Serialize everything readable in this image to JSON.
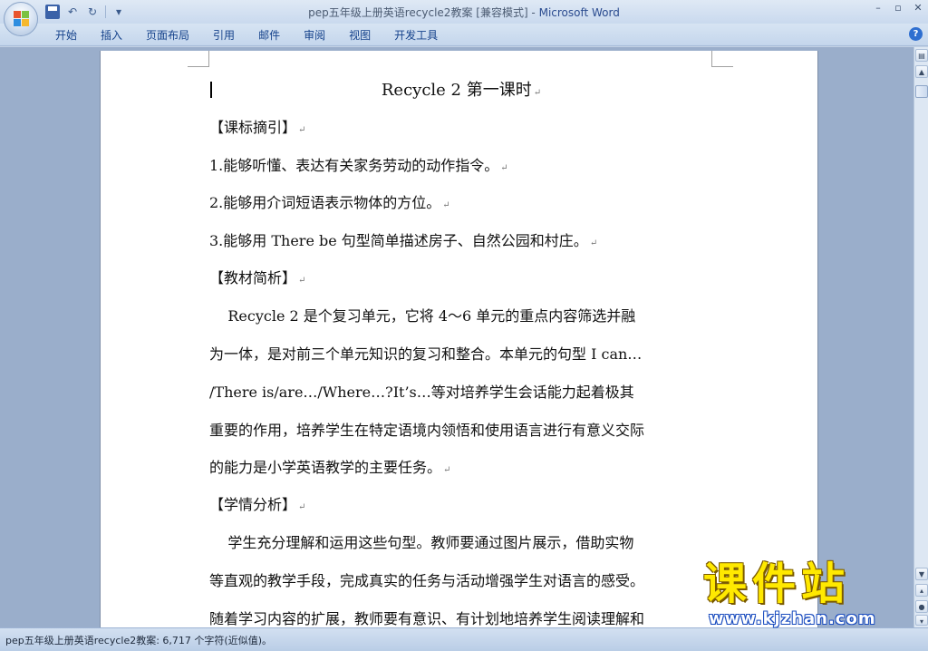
{
  "window": {
    "title_doc": "pep五年级上册英语recycle2教案 [兼容模式] - ",
    "title_app": "Microsoft Word"
  },
  "quick_access": {
    "icons": [
      "save-icon",
      "undo-icon",
      "redo-icon",
      "customize-icon"
    ]
  },
  "ribbon": {
    "tabs": [
      "开始",
      "插入",
      "页面布局",
      "引用",
      "邮件",
      "审阅",
      "视图",
      "开发工具"
    ],
    "help": "?"
  },
  "document": {
    "title": "Recycle 2  第一课时",
    "lines": [
      "【课标摘引】",
      "1.能够听懂、表达有关家务劳动的动作指令。",
      "2.能够用介词短语表示物体的方位。",
      "3.能够用 There be 句型简单描述房子、自然公园和村庄。",
      "【教材简析】",
      "    Recycle 2 是个复习单元，它将 4～6 单元的重点内容筛选并融",
      "为一体，是对前三个单元知识的复习和整合。本单元的句型 I can…",
      "/There is/are…/Where…?It’s…等对培养学生会话能力起着极其",
      "重要的作用，培养学生在特定语境内领悟和使用语言进行有意义交际",
      "的能力是小学英语教学的主要任务。",
      "【学情分析】",
      "    学生充分理解和运用这些句型。教师要通过图片展示，借助实物",
      "等直观的教学手段，完成真实的任务与活动增强学生对语言的感受。",
      "随着学习内容的扩展，教师要有意识、有计划地培养学生阅读理解和"
    ],
    "para_marks": [
      true,
      true,
      true,
      true,
      true,
      true,
      false,
      false,
      false,
      false,
      true,
      true,
      false,
      false,
      false
    ]
  },
  "status": {
    "text": "pep五年级上册英语recycle2教案: 6,717 个字符(近似值)。"
  },
  "watermark": {
    "big": "课件站",
    "url": "www.kjzhan.com"
  }
}
